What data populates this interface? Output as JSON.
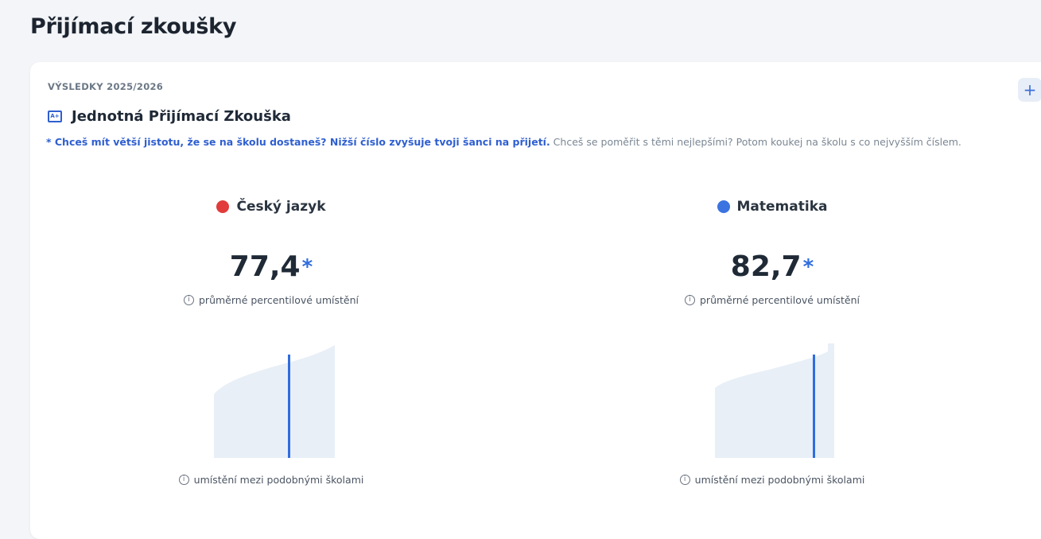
{
  "page": {
    "title": "Přijímací zkoušky"
  },
  "card": {
    "section_label": "VÝSLEDKY 2025/2026",
    "plus_label": "+",
    "exam_title": "Jednotná Přijímací Zkouška",
    "exam_icon": "certificate-icon",
    "note_highlight": "* Chceš mít větší jistotu, že se na školu dostaneš? Nižší číslo zvyšuje tvoji šanci na přijetí.",
    "note_rest": " Chceš se poměřit s těmi nejlepšími? Potom koukej na školu s co nejvyšším číslem."
  },
  "subjects": [
    {
      "name": "Český jazyk",
      "color": "#e23b3b",
      "score": "77,4",
      "star": "*",
      "score_caption": "průměrné percentilové umístění",
      "distribution_caption": "umístění mezi podobnými školami",
      "marker_percentile": 0.63
    },
    {
      "name": "Matematika",
      "color": "#3b73e0",
      "score": "82,7",
      "star": "*",
      "score_caption": "průměrné percentilové umístění",
      "distribution_caption": "umístění mezi podobnými školami",
      "marker_percentile": 0.83
    }
  ],
  "icons": {
    "info": "info-icon",
    "plus": "plus-icon"
  }
}
